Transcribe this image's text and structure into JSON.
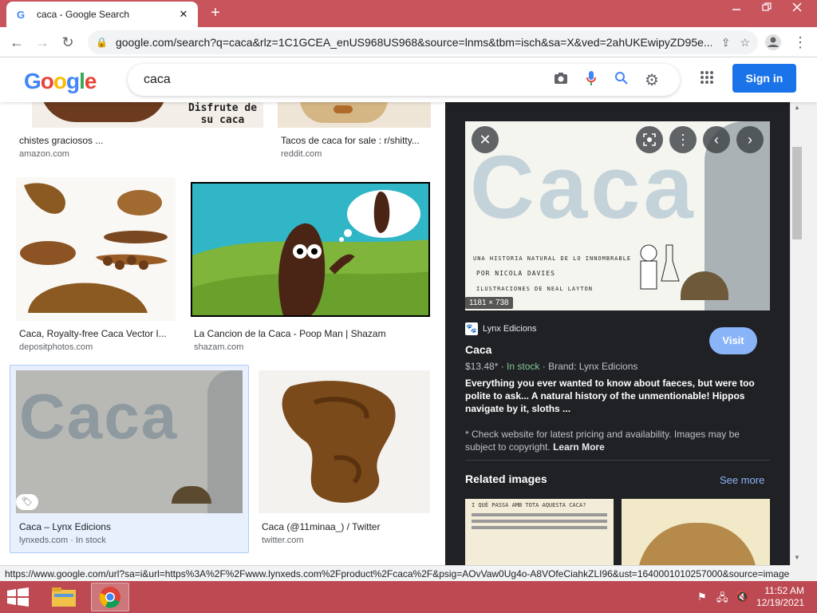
{
  "browser": {
    "tab_title": "caca - Google Search",
    "tab_favicon": "G",
    "tab_close": "✕",
    "new_tab": "+",
    "url": "google.com/search?q=caca&rlz=1C1GCEA_enUS968US968&source=lnms&tbm=isch&sa=X&ved=2ahUKEwipyZD95e..."
  },
  "google": {
    "logo": "Google",
    "query": "caca",
    "sign_in": "Sign in"
  },
  "results": [
    {
      "title": "chistes graciosos ...",
      "source": "amazon.com",
      "thumb_text": "Disfrute de su caca"
    },
    {
      "title": "Tacos de caca for sale : r/shitty...",
      "source": "reddit.com"
    },
    {
      "title": "Caca, Royalty-free Caca Vector I...",
      "source": "depositphotos.com"
    },
    {
      "title": "La Cancion de la Caca - Poop Man | Shazam",
      "source": "shazam.com"
    },
    {
      "title": "Caca – Lynx Edicions",
      "source": "lynxeds.com",
      "stock": "In stock",
      "thumb_text": "Caca"
    },
    {
      "title": "Caca (@11minaa_) / Twitter",
      "source": "twitter.com"
    }
  ],
  "panel": {
    "image_text": "Caca",
    "image_sub1": "UNA HISTORIA NATURAL DE LO INNOMBRABLE",
    "image_sub2": "POR NICOLA DAVIES",
    "image_sub3": "ILUSTRACIONES DE NEAL LAYTON",
    "dimensions": "1181 × 738",
    "source_name": "Lynx Edicions",
    "visit": "Visit",
    "title": "Caca",
    "price": "$13.48*",
    "stock": "In stock",
    "brand": "Brand: Lynx Edicions",
    "description": "Everything you ever wanted to know about faeces, but were too polite to ask... A natural history of the unmentionable! Hippos navigate by it, sloths ...",
    "note": "* Check website for latest pricing and availability. Images may be subject to copyright.",
    "learn_more": "Learn More",
    "related_title": "Related images",
    "see_more": "See more",
    "related1_text": "I QUÈ PASSA AMB TOTA AQUESTA CACA?"
  },
  "status_url": "https://www.google.com/url?sa=i&url=https%3A%2F%2Fwww.lynxeds.com%2Fproduct%2Fcaca%2F&psig=AOvVaw0Ug4o-A8VOfeCiahkZLI96&ust=1640001010257000&source=image...",
  "taskbar": {
    "time": "11:52 AM",
    "date": "12/19/2021"
  },
  "colors": {
    "accent": "#1a73e8",
    "tabbar": "#c8545c",
    "taskbar": "#bd4a52",
    "panel_bg": "#202124"
  }
}
